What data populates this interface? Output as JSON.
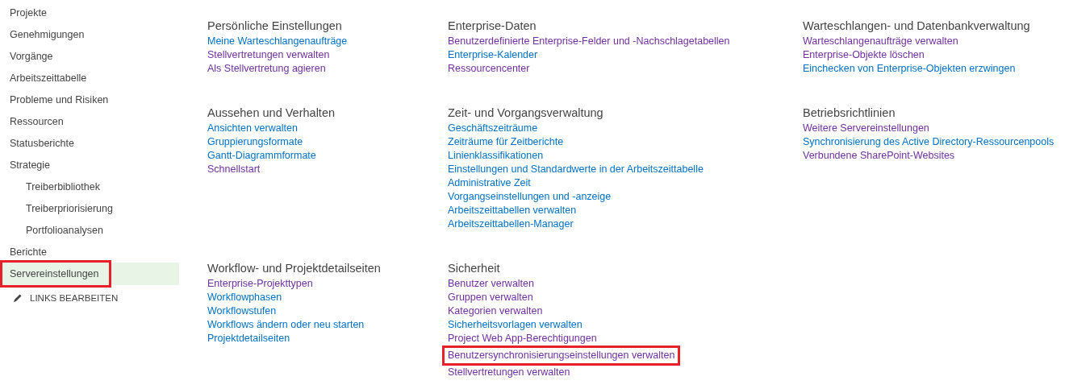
{
  "sidebar": {
    "items": [
      {
        "label": "Projekte",
        "selected": false,
        "highlighted": false
      },
      {
        "label": "Genehmigungen",
        "selected": false,
        "highlighted": false
      },
      {
        "label": "Vorgänge",
        "selected": false,
        "highlighted": false
      },
      {
        "label": "Arbeitszeittabelle",
        "selected": false,
        "highlighted": false
      },
      {
        "label": "Probleme und Risiken",
        "selected": false,
        "highlighted": false
      },
      {
        "label": "Ressourcen",
        "selected": false,
        "highlighted": false
      },
      {
        "label": "Statusberichte",
        "selected": false,
        "highlighted": false
      },
      {
        "label": "Strategie",
        "selected": false,
        "highlighted": false,
        "children": [
          {
            "label": "Treiberbibliothek",
            "selected": false,
            "highlighted": false
          },
          {
            "label": "Treiberpriorisierung",
            "selected": false,
            "highlighted": false
          },
          {
            "label": "Portfolioanalysen",
            "selected": false,
            "highlighted": false
          }
        ]
      },
      {
        "label": "Berichte",
        "selected": false,
        "highlighted": false
      },
      {
        "label": "Servereinstellungen",
        "selected": true,
        "highlighted": true
      }
    ],
    "edit_links": "LINKS BEARBEITEN"
  },
  "section_rows": [
    [
      {
        "title": "Persönliche Einstellungen",
        "links": [
          {
            "label": "Meine Warteschlangenaufträge",
            "visited": false,
            "highlighted": false
          },
          {
            "label": "Stellvertretungen verwalten",
            "visited": true,
            "highlighted": false
          },
          {
            "label": "Als Stellvertretung agieren",
            "visited": true,
            "highlighted": false
          }
        ]
      },
      {
        "title": "Enterprise-Daten",
        "links": [
          {
            "label": "Benutzerdefinierte Enterprise-Felder und -Nachschlagetabellen",
            "visited": true,
            "highlighted": false
          },
          {
            "label": "Enterprise-Kalender",
            "visited": false,
            "highlighted": false
          },
          {
            "label": "Ressourcencenter",
            "visited": true,
            "highlighted": false
          }
        ]
      },
      {
        "title": "Warteschlangen- und Datenbankverwaltung",
        "links": [
          {
            "label": "Warteschlangenaufträge verwalten",
            "visited": true,
            "highlighted": false
          },
          {
            "label": "Enterprise-Objekte löschen",
            "visited": true,
            "highlighted": false
          },
          {
            "label": "Einchecken von Enterprise-Objekten erzwingen",
            "visited": false,
            "highlighted": false
          }
        ]
      }
    ],
    [
      {
        "title": "Aussehen und Verhalten",
        "links": [
          {
            "label": "Ansichten verwalten",
            "visited": false,
            "highlighted": false
          },
          {
            "label": "Gruppierungsformate",
            "visited": false,
            "highlighted": false
          },
          {
            "label": "Gantt-Diagrammformate",
            "visited": false,
            "highlighted": false
          },
          {
            "label": "Schnellstart",
            "visited": true,
            "highlighted": false
          }
        ]
      },
      {
        "title": "Zeit- und Vorgangsverwaltung",
        "links": [
          {
            "label": "Geschäftszeiträume",
            "visited": false,
            "highlighted": false
          },
          {
            "label": "Zeiträume für Zeitberichte",
            "visited": false,
            "highlighted": false
          },
          {
            "label": "Linienklassifikationen",
            "visited": false,
            "highlighted": false
          },
          {
            "label": "Einstellungen und Standardwerte in der Arbeitszeittabelle",
            "visited": false,
            "highlighted": false
          },
          {
            "label": "Administrative Zeit",
            "visited": false,
            "highlighted": false
          },
          {
            "label": "Vorgangseinstellungen und -anzeige",
            "visited": false,
            "highlighted": false
          },
          {
            "label": "Arbeitszeittabellen verwalten",
            "visited": false,
            "highlighted": false
          },
          {
            "label": "Arbeitszeittabellen-Manager",
            "visited": false,
            "highlighted": false
          }
        ]
      },
      {
        "title": "Betriebsrichtlinien",
        "links": [
          {
            "label": "Weitere Servereinstellungen",
            "visited": true,
            "highlighted": false
          },
          {
            "label": "Synchronisierung des Active Directory-Ressourcenpools",
            "visited": false,
            "highlighted": false
          },
          {
            "label": "Verbundene SharePoint-Websites",
            "visited": true,
            "highlighted": false
          }
        ]
      }
    ],
    [
      {
        "title": "Workflow- und Projektdetailseiten",
        "links": [
          {
            "label": "Enterprise-Projekttypen",
            "visited": true,
            "highlighted": false
          },
          {
            "label": "Workflowphasen",
            "visited": false,
            "highlighted": false
          },
          {
            "label": "Workflowstufen",
            "visited": false,
            "highlighted": false
          },
          {
            "label": "Workflows ändern oder neu starten",
            "visited": false,
            "highlighted": false
          },
          {
            "label": "Projektdetailseiten",
            "visited": false,
            "highlighted": false
          }
        ]
      },
      {
        "title": "Sicherheit",
        "links": [
          {
            "label": "Benutzer verwalten",
            "visited": true,
            "highlighted": false
          },
          {
            "label": "Gruppen verwalten",
            "visited": true,
            "highlighted": false
          },
          {
            "label": "Kategorien verwalten",
            "visited": true,
            "highlighted": false
          },
          {
            "label": "Sicherheitsvorlagen verwalten",
            "visited": false,
            "highlighted": false
          },
          {
            "label": "Project Web App-Berechtigungen",
            "visited": true,
            "highlighted": false
          },
          {
            "label": "Benutzersynchronisierungseinstellungen verwalten",
            "visited": true,
            "highlighted": true
          },
          {
            "label": "Stellvertretungen verwalten",
            "visited": true,
            "highlighted": false
          }
        ]
      }
    ]
  ]
}
